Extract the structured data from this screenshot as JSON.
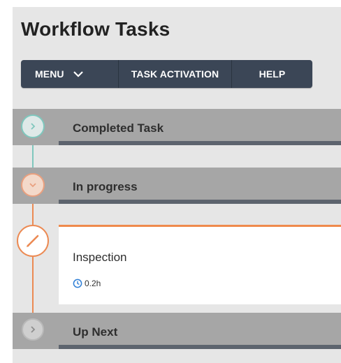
{
  "page_title": "Workflow Tasks",
  "toolbar": {
    "menu_label": "MENU",
    "task_activation_label": "TASK ACTIVATION",
    "help_label": "HELP"
  },
  "stages": {
    "completed": {
      "label": "Completed Task"
    },
    "in_progress": {
      "label": "In progress"
    },
    "up_next": {
      "label": "Up Next"
    }
  },
  "active_task": {
    "title": "Inspection",
    "duration": "0.2h"
  },
  "icons": {
    "completed": "chevron-right-icon",
    "in_progress": "chevron-down-icon",
    "active": "pencil-icon",
    "up_next": "chevron-right-icon",
    "duration": "clock-icon"
  },
  "colors": {
    "toolbar_bg": "#3b4656",
    "completed_accent": "#7fc7bd",
    "progress_accent": "#ec8a53",
    "band_bg": "#a6a6a6",
    "band_underbar": "#5d646e",
    "clock": "#2f7fd6"
  }
}
